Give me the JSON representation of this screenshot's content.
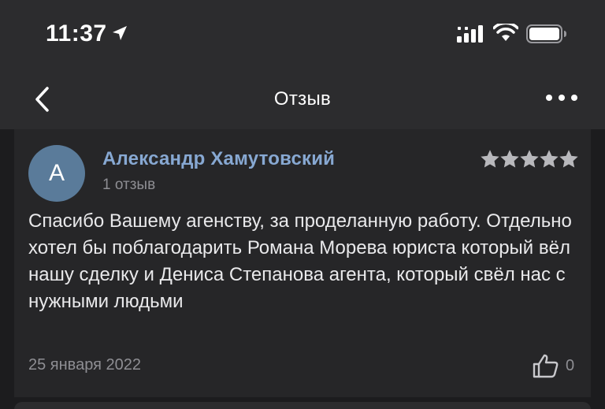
{
  "status_bar": {
    "time": "11:37",
    "icons": [
      "location-arrow-icon",
      "cellular-signal-icon",
      "wifi-icon",
      "battery-icon"
    ]
  },
  "nav": {
    "title": "Отзыв",
    "back_icon": "chevron-left-icon",
    "more_icon": "more-dots-icon"
  },
  "review": {
    "avatar_letter": "А",
    "author": "Александр Хамутовский",
    "review_count": "1 отзыв",
    "rating": 5,
    "rating_max": 5,
    "text": "Спасибо Вашему агенству, за проделанную работу. Отдельно хотел бы поблагодарить Романа Морева юриста который вёл нашу сделку и Дениса Степанова агента, который свёл нас с нужными людьми",
    "date": "25 января 2022",
    "likes": "0"
  },
  "colors": {
    "background": "#1c1c1e",
    "bar": "#2c2c2e",
    "card": "#262628",
    "author_link": "#87a8d2",
    "avatar": "#5a7b9a",
    "secondary_text": "#8e8e93",
    "star": "#b8b8bc"
  }
}
